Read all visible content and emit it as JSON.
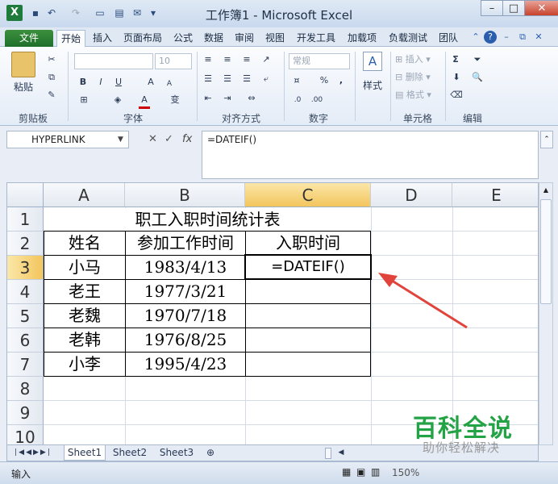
{
  "window": {
    "title": "工作簿1 - Microsoft Excel",
    "app_icon": "X",
    "quick_access": [
      "save-icon",
      "undo-icon",
      "redo-icon",
      "customize-icon"
    ],
    "controls": [
      "minimize-icon",
      "restore-icon",
      "close-icon"
    ]
  },
  "ribbon_tabs": [
    "文件",
    "开始",
    "插入",
    "页面布局",
    "公式",
    "数据",
    "审阅",
    "视图",
    "开发工具",
    "加载项",
    "负载测试",
    "团队"
  ],
  "active_tab": "开始",
  "ribbon": {
    "clipboard": {
      "paste": "粘贴",
      "label": "剪贴板"
    },
    "font": {
      "size": "10",
      "bold": "B",
      "italic": "I",
      "underline": "U",
      "grow": "A",
      "shrink": "A",
      "font_color": "A",
      "wen": "变",
      "label": "字体"
    },
    "alignment": {
      "label": "对齐方式"
    },
    "number": {
      "format": "常规",
      "percent": "%",
      "comma": ",",
      "label": "数字"
    },
    "styles": {
      "button": "样式",
      "label": ""
    },
    "cells": {
      "insert": "插入",
      "delete": "删除",
      "format": "格式",
      "label": "单元格"
    },
    "editing": {
      "sum": "Σ",
      "label": "编辑"
    }
  },
  "formula_bar": {
    "name_box": "HYPERLINK",
    "fx": "fx",
    "cancel": "✕",
    "confirm": "✓",
    "formula": "=DATEIF()"
  },
  "columns": [
    "A",
    "B",
    "C",
    "D",
    "E"
  ],
  "selected_column": "C",
  "rows": [
    "1",
    "2",
    "3",
    "4",
    "5",
    "6",
    "7",
    "8",
    "9",
    "10"
  ],
  "selected_row": "3",
  "table": {
    "title": "职工入职时间统计表",
    "headers": [
      "姓名",
      "参加工作时间",
      "入职时间"
    ],
    "names": [
      "小马",
      "老王",
      "老魏",
      "老韩",
      "小李"
    ],
    "dates": [
      "1983/4/13",
      "1977/3/21",
      "1970/7/18",
      "1976/8/25",
      "1995/4/23"
    ],
    "editing_cell": "=DATEIF()"
  },
  "sheets": [
    "Sheet1",
    "Sheet2",
    "Sheet3"
  ],
  "active_sheet": "Sheet1",
  "status": {
    "mode": "输入",
    "zoom": "150%"
  },
  "watermark": {
    "title": "百科全说",
    "subtitle": "助你轻松解决"
  }
}
